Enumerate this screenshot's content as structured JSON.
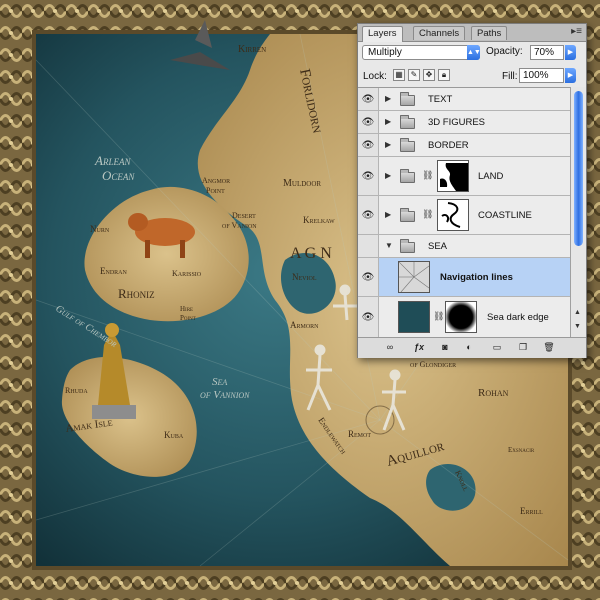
{
  "map": {
    "labels": {
      "kirren": "Kirren",
      "forlidorn": "Forlidorn",
      "arlean_ocean_1": "Arlean",
      "arlean_ocean_2": "Ocean",
      "angmor_point_1": "Angmor",
      "angmor_point_2": "Point",
      "muldoor": "Muldoor",
      "desert_1": "Desert",
      "desert_2": "of Vanion",
      "krelkaw": "Krelkaw",
      "agn": "A G N",
      "nurn": "Nurn",
      "endran": "Endran",
      "karissio": "Karissio",
      "rhoniz": "Rhoniz",
      "hire_point_1": "Hire",
      "hire_point_2": "Point",
      "neviol": "Neviol",
      "gulf": "Gulf of Chembor",
      "armorn": "Armorn",
      "rhuda": "Rhuda",
      "sea_vannion_1": "Sea",
      "sea_vannion_2": "of Vannion",
      "amak_isle": "Amak Isle",
      "kuba": "Kuba",
      "glondiger": "of Glondiger",
      "rohan": "Rohan",
      "remot": "Remot",
      "endlewatch": "Endlewatch",
      "aquillor": "Aquillor",
      "knoll": "Knoll",
      "exsnacir": "Exsnacir",
      "errill": "Errill"
    }
  },
  "layers_panel": {
    "tabs": [
      "Layers",
      "Channels",
      "Paths"
    ],
    "active_tab": "Layers",
    "blend_mode": "Multiply",
    "opacity_label": "Opacity:",
    "opacity_value": "70%",
    "lock_label": "Lock:",
    "fill_label": "Fill:",
    "fill_value": "100%",
    "layers": [
      {
        "name": "TEXT",
        "type": "group"
      },
      {
        "name": "3D FIGURES",
        "type": "group"
      },
      {
        "name": "BORDER",
        "type": "group"
      },
      {
        "name": "LAND",
        "type": "group-mask"
      },
      {
        "name": "COASTLINE",
        "type": "group-mask"
      },
      {
        "name": "SEA",
        "type": "group-open"
      },
      {
        "name": "Navigation lines",
        "type": "layer-selected"
      },
      {
        "name": "Sea dark edge",
        "type": "layer-mask"
      }
    ],
    "colors": {
      "selected_row": "#b7d2f5",
      "accent": "#2b6fe0",
      "sea": "#1f4d57",
      "land": "#c9a86a"
    }
  }
}
